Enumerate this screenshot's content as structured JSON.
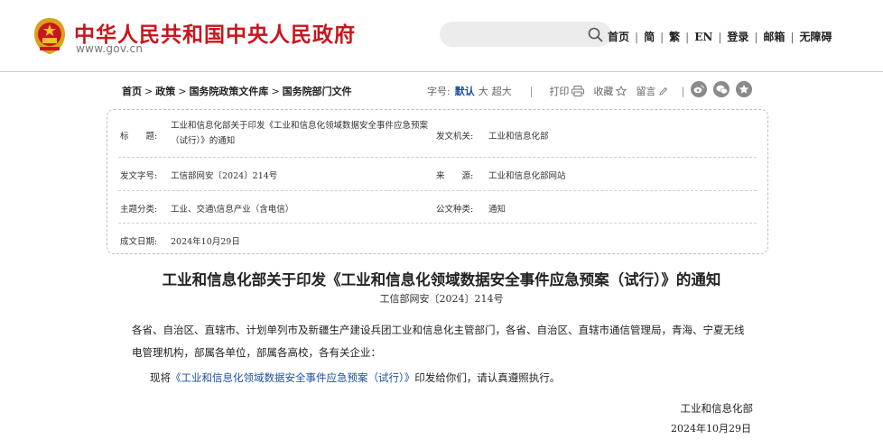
{
  "header": {
    "site_title": "中华人民共和国中央人民政府",
    "site_url": "www.gov.cn",
    "search_placeholder": "",
    "nav": [
      "首页",
      "简",
      "繁",
      "EN",
      "登录",
      "邮箱",
      "无障碍"
    ]
  },
  "breadcrumb": [
    "首页",
    "政策",
    "国务院政策文件库",
    "国务院部门文件"
  ],
  "tools": {
    "fontsize_label": "字号:",
    "fontsizes": [
      "默认",
      "大",
      "超大"
    ],
    "separator": "|",
    "print": "打印",
    "favorite": "收藏",
    "comment": "留言",
    "trailing_sep": "|"
  },
  "share_icons": [
    "weibo-icon",
    "wechat-icon",
    "qzone-icon"
  ],
  "meta": {
    "title_label": "标　　题:",
    "title_value": "工业和信息化部关于印发《工业和信息化领域数据安全事件应急预案（试行）》的通知",
    "issuer_label": "发文机关:",
    "issuer_value": "工业和信息化部",
    "docno_label": "发文字号:",
    "docno_value": "工信部网安〔2024〕214号",
    "source_label": "来　　源:",
    "source_value": "工业和信息化部网站",
    "topic_label": "主题分类:",
    "topic_value": "工业、交通\\信息产业（含电信）",
    "type_label": "公文种类:",
    "type_value": "通知",
    "date_label": "成文日期:",
    "date_value": "2024年10月29日"
  },
  "article": {
    "title": "工业和信息化部关于印发《工业和信息化领域数据安全事件应急预案（试行）》的通知",
    "doc_no": "工信部网安〔2024〕214号",
    "recipients": "各省、自治区、直辖市、计划单列市及新疆生产建设兵团工业和信息化主管部门，各省、自治区、直辖市通信管理局，青海、宁夏无线电管理机构，部属各单位，部属各高校，各有关企业：",
    "body_prefix": "现将",
    "body_link": "《工业和信息化领域数据安全事件应急预案（试行）》",
    "body_suffix": "印发给你们，请认真遵照执行。",
    "signer": "工业和信息化部",
    "sign_date": "2024年10月29日"
  },
  "colors": {
    "brand_red": "#c8161d",
    "link_blue": "#1d4fa3"
  }
}
